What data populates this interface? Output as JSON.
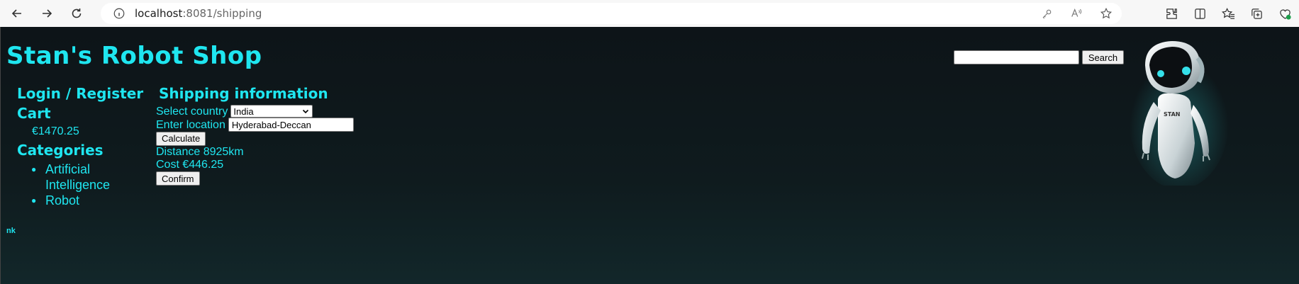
{
  "browser": {
    "url_host": "localhost",
    "url_rest": ":8081/shipping"
  },
  "site": {
    "title": "Stan's Robot Shop",
    "robot_badge": "STAN"
  },
  "search": {
    "value": "",
    "button_label": "Search"
  },
  "sidebar": {
    "login_label": "Login / Register",
    "cart_label": "Cart",
    "cart_total": "€1470.25",
    "categories_label": "Categories",
    "categories": [
      "Artificial Intelligence",
      "Robot"
    ]
  },
  "shipping": {
    "title": "Shipping information",
    "country_label": "Select country",
    "country_selected": "India",
    "location_label": "Enter location",
    "location_value": "Hyderabad-Deccan",
    "calculate_label": "Calculate",
    "distance_text": "Distance 8925km",
    "cost_text": "Cost €446.25",
    "confirm_label": "Confirm"
  },
  "footer": {
    "text": "nk"
  },
  "colors": {
    "accent": "#1fe6f0",
    "background": "#0f1b1e"
  }
}
